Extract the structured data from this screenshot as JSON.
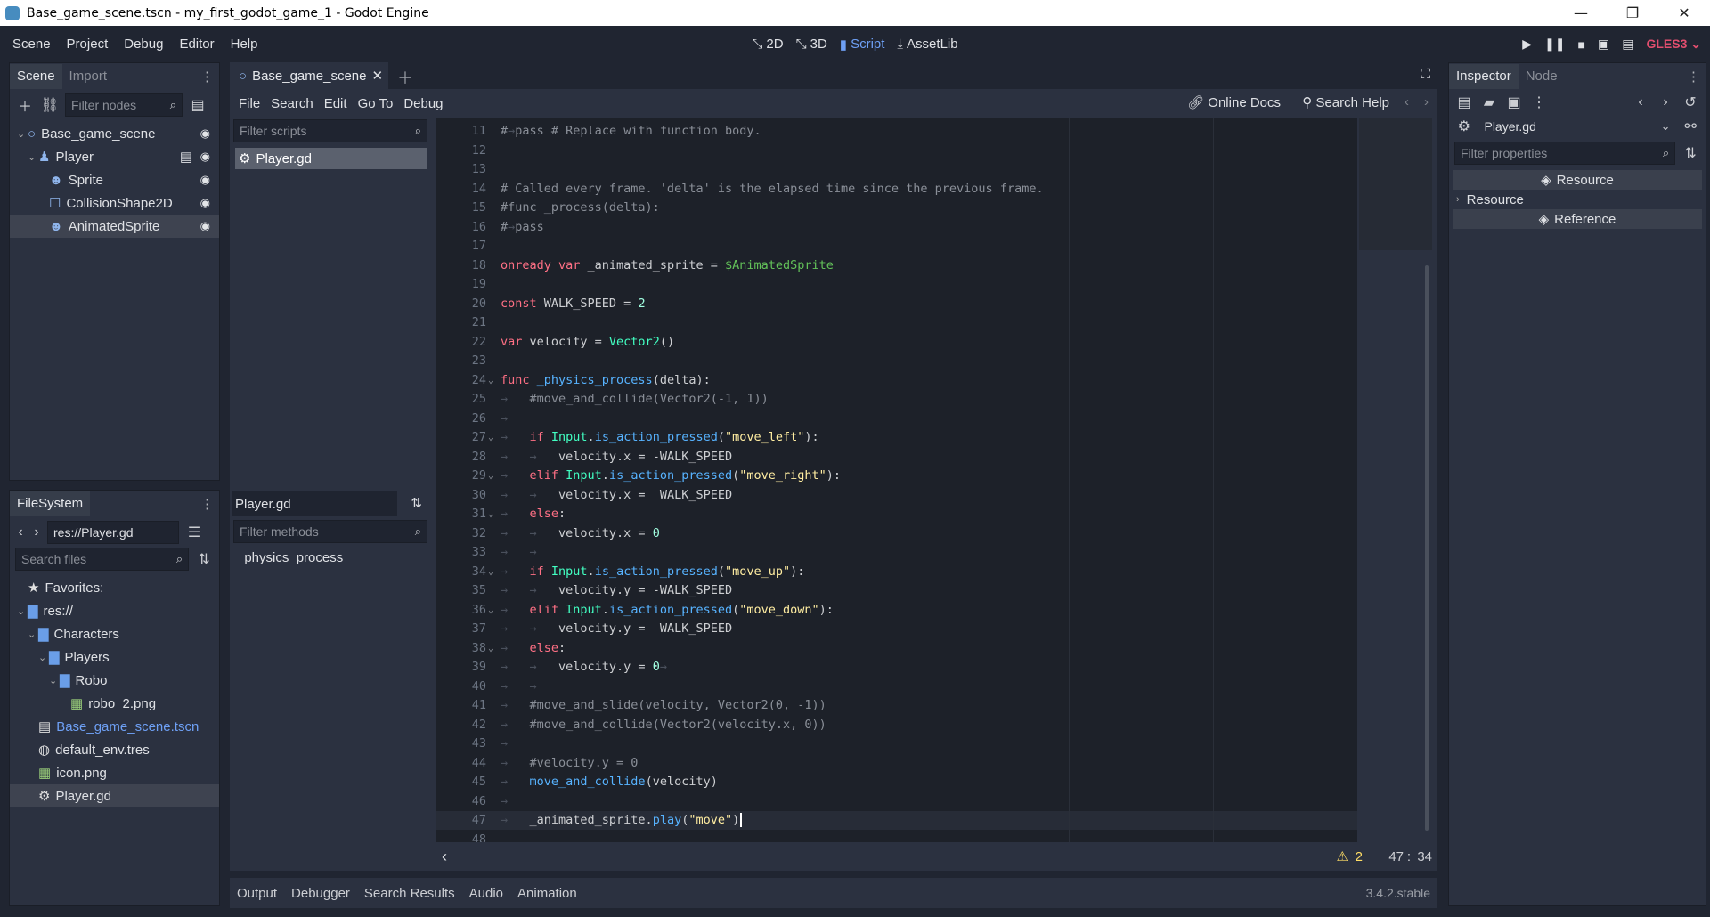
{
  "window": {
    "title": "Base_game_scene.tscn - my_first_godot_game_1 - Godot Engine",
    "minimize": "—",
    "maximize": "❐",
    "close": "✕"
  },
  "menu": [
    "Scene",
    "Project",
    "Debug",
    "Editor",
    "Help"
  ],
  "workspaces": [
    {
      "label": "2D",
      "icon": "2d-icon",
      "active": false
    },
    {
      "label": "3D",
      "icon": "3d-icon",
      "active": false
    },
    {
      "label": "Script",
      "icon": "script-icon",
      "active": true
    },
    {
      "label": "AssetLib",
      "icon": "assetlib-icon",
      "active": false
    }
  ],
  "renderer": "GLES3",
  "scene_dock": {
    "tabs": [
      "Scene",
      "Import"
    ],
    "filter_placeholder": "Filter nodes",
    "nodes": [
      {
        "name": "Base_game_scene",
        "depth": 0,
        "icon": "node2d-icon",
        "visible": true,
        "expanded": true
      },
      {
        "name": "Player",
        "depth": 1,
        "icon": "kinematicbody-icon",
        "visible": true,
        "expanded": true,
        "script": true
      },
      {
        "name": "Sprite",
        "depth": 2,
        "icon": "sprite-icon",
        "visible": true
      },
      {
        "name": "CollisionShape2D",
        "depth": 2,
        "icon": "collisionshape-icon",
        "visible": true
      },
      {
        "name": "AnimatedSprite",
        "depth": 2,
        "icon": "animatedsprite-icon",
        "visible": true,
        "selected": true
      }
    ]
  },
  "filesystem": {
    "tab": "FileSystem",
    "path": "res://Player.gd",
    "search_placeholder": "Search files",
    "items": [
      {
        "name": "Favorites:",
        "depth": 0,
        "icon": "star-icon"
      },
      {
        "name": "res://",
        "depth": 0,
        "icon": "folder-icon",
        "expanded": true
      },
      {
        "name": "Characters",
        "depth": 1,
        "icon": "folder-icon",
        "expanded": true
      },
      {
        "name": "Players",
        "depth": 2,
        "icon": "folder-icon",
        "expanded": true
      },
      {
        "name": "Robo",
        "depth": 3,
        "icon": "folder-icon",
        "expanded": true
      },
      {
        "name": "robo_2.png",
        "depth": 4,
        "icon": "image-icon"
      },
      {
        "name": "Base_game_scene.tscn",
        "depth": 1,
        "icon": "scene-icon",
        "highlight": true
      },
      {
        "name": "default_env.tres",
        "depth": 1,
        "icon": "globe-icon"
      },
      {
        "name": "icon.png",
        "depth": 1,
        "icon": "image-icon"
      },
      {
        "name": "Player.gd",
        "depth": 1,
        "icon": "gear-icon",
        "selected": true
      }
    ]
  },
  "script_editor": {
    "open_tab": "Base_game_scene",
    "menu": [
      "File",
      "Search",
      "Edit",
      "Go To",
      "Debug"
    ],
    "online_docs": "Online Docs",
    "search_help": "Search Help",
    "filter_scripts_placeholder": "Filter scripts",
    "scripts": [
      "Player.gd"
    ],
    "current_script": "Player.gd",
    "filter_methods_placeholder": "Filter methods",
    "methods": [
      "_physics_process"
    ],
    "status": {
      "warnings": "2",
      "line": "47",
      "sep": ":",
      "col": "34"
    },
    "lines": [
      {
        "n": "11",
        "tokens": [
          [
            "c-comment",
            "#"
          ],
          [
            "tabsym",
            "→"
          ],
          [
            "c-comment",
            "pass # Replace with function body."
          ]
        ]
      },
      {
        "n": "12",
        "tokens": []
      },
      {
        "n": "13",
        "tokens": []
      },
      {
        "n": "14",
        "tokens": [
          [
            "c-comment",
            "# Called every frame. 'delta' is the elapsed time since the previous frame."
          ]
        ]
      },
      {
        "n": "15",
        "tokens": [
          [
            "c-comment",
            "#func _process(delta):"
          ]
        ]
      },
      {
        "n": "16",
        "tokens": [
          [
            "c-comment",
            "#"
          ],
          [
            "tabsym",
            "→"
          ],
          [
            "c-comment",
            "pass"
          ]
        ]
      },
      {
        "n": "17",
        "tokens": []
      },
      {
        "n": "18",
        "tokens": [
          [
            "c-kw",
            "onready var "
          ],
          [
            "c-id",
            "_animated_sprite = "
          ],
          [
            "c-node",
            "$AnimatedSprite"
          ]
        ]
      },
      {
        "n": "19",
        "tokens": []
      },
      {
        "n": "20",
        "tokens": [
          [
            "c-kw",
            "const "
          ],
          [
            "c-id",
            "WALK_SPEED = "
          ],
          [
            "c-num",
            "2"
          ]
        ]
      },
      {
        "n": "21",
        "tokens": []
      },
      {
        "n": "22",
        "tokens": [
          [
            "c-kw",
            "var "
          ],
          [
            "c-id",
            "velocity = "
          ],
          [
            "c-type",
            "Vector2"
          ],
          [
            "c-id",
            "()"
          ]
        ]
      },
      {
        "n": "23",
        "tokens": []
      },
      {
        "n": "24",
        "fold": true,
        "tokens": [
          [
            "c-kw",
            "func "
          ],
          [
            "c-fn",
            "_physics_process"
          ],
          [
            "c-id",
            "(delta):"
          ]
        ]
      },
      {
        "n": "25",
        "tokens": [
          [
            "tabsym",
            "→   "
          ],
          [
            "c-comment",
            "#move_and_collide(Vector2(-1, 1))"
          ]
        ]
      },
      {
        "n": "26",
        "tokens": [
          [
            "tabsym",
            "→"
          ]
        ]
      },
      {
        "n": "27",
        "fold": true,
        "tokens": [
          [
            "tabsym",
            "→   "
          ],
          [
            "c-kw",
            "if "
          ],
          [
            "c-type",
            "Input"
          ],
          [
            "c-id",
            "."
          ],
          [
            "c-fn",
            "is_action_pressed"
          ],
          [
            "c-id",
            "("
          ],
          [
            "c-str",
            "\"move_left\""
          ],
          [
            "c-id",
            "):"
          ]
        ]
      },
      {
        "n": "28",
        "tokens": [
          [
            "tabsym",
            "→   →   "
          ],
          [
            "c-id",
            "velocity.x = -WALK_SPEED"
          ]
        ]
      },
      {
        "n": "29",
        "fold": true,
        "tokens": [
          [
            "tabsym",
            "→   "
          ],
          [
            "c-kw",
            "elif "
          ],
          [
            "c-type",
            "Input"
          ],
          [
            "c-id",
            "."
          ],
          [
            "c-fn",
            "is_action_pressed"
          ],
          [
            "c-id",
            "("
          ],
          [
            "c-str",
            "\"move_right\""
          ],
          [
            "c-id",
            "):"
          ]
        ]
      },
      {
        "n": "30",
        "tokens": [
          [
            "tabsym",
            "→   →   "
          ],
          [
            "c-id",
            "velocity.x =  WALK_SPEED"
          ]
        ]
      },
      {
        "n": "31",
        "fold": true,
        "tokens": [
          [
            "tabsym",
            "→   "
          ],
          [
            "c-kw",
            "else"
          ],
          [
            "c-id",
            ":"
          ]
        ]
      },
      {
        "n": "32",
        "tokens": [
          [
            "tabsym",
            "→   →   "
          ],
          [
            "c-id",
            "velocity.x = "
          ],
          [
            "c-num",
            "0"
          ]
        ]
      },
      {
        "n": "33",
        "tokens": [
          [
            "tabsym",
            "→   →"
          ]
        ]
      },
      {
        "n": "34",
        "fold": true,
        "tokens": [
          [
            "tabsym",
            "→   "
          ],
          [
            "c-kw",
            "if "
          ],
          [
            "c-type",
            "Input"
          ],
          [
            "c-id",
            "."
          ],
          [
            "c-fn",
            "is_action_pressed"
          ],
          [
            "c-id",
            "("
          ],
          [
            "c-str",
            "\"move_up\""
          ],
          [
            "c-id",
            "):"
          ]
        ]
      },
      {
        "n": "35",
        "tokens": [
          [
            "tabsym",
            "→   →   "
          ],
          [
            "c-id",
            "velocity.y = -WALK_SPEED"
          ]
        ]
      },
      {
        "n": "36",
        "fold": true,
        "tokens": [
          [
            "tabsym",
            "→   "
          ],
          [
            "c-kw",
            "elif "
          ],
          [
            "c-type",
            "Input"
          ],
          [
            "c-id",
            "."
          ],
          [
            "c-fn",
            "is_action_pressed"
          ],
          [
            "c-id",
            "("
          ],
          [
            "c-str",
            "\"move_down\""
          ],
          [
            "c-id",
            "):"
          ]
        ]
      },
      {
        "n": "37",
        "tokens": [
          [
            "tabsym",
            "→   →   "
          ],
          [
            "c-id",
            "velocity.y =  WALK_SPEED"
          ]
        ]
      },
      {
        "n": "38",
        "fold": true,
        "tokens": [
          [
            "tabsym",
            "→   "
          ],
          [
            "c-kw",
            "else"
          ],
          [
            "c-id",
            ":"
          ]
        ]
      },
      {
        "n": "39",
        "tokens": [
          [
            "tabsym",
            "→   →   "
          ],
          [
            "c-id",
            "velocity.y = "
          ],
          [
            "c-num",
            "0"
          ],
          [
            "tabsym",
            "→"
          ]
        ]
      },
      {
        "n": "40",
        "tokens": [
          [
            "tabsym",
            "→   →"
          ]
        ]
      },
      {
        "n": "41",
        "tokens": [
          [
            "tabsym",
            "→   "
          ],
          [
            "c-comment",
            "#move_and_slide(velocity, Vector2(0, -1))"
          ]
        ]
      },
      {
        "n": "42",
        "tokens": [
          [
            "tabsym",
            "→   "
          ],
          [
            "c-comment",
            "#move_and_collide(Vector2(velocity.x, 0))"
          ]
        ]
      },
      {
        "n": "43",
        "tokens": [
          [
            "tabsym",
            "→"
          ]
        ]
      },
      {
        "n": "44",
        "tokens": [
          [
            "tabsym",
            "→   "
          ],
          [
            "c-comment",
            "#velocity.y = 0"
          ]
        ]
      },
      {
        "n": "45",
        "tokens": [
          [
            "tabsym",
            "→   "
          ],
          [
            "c-fn",
            "move_and_collide"
          ],
          [
            "c-id",
            "(velocity)"
          ]
        ]
      },
      {
        "n": "46",
        "tokens": [
          [
            "tabsym",
            "→"
          ]
        ]
      },
      {
        "n": "47",
        "current": true,
        "tokens": [
          [
            "tabsym",
            "→   "
          ],
          [
            "c-id",
            "_animated_sprite."
          ],
          [
            "c-fn",
            "play"
          ],
          [
            "c-id",
            "("
          ],
          [
            "c-str",
            "\"move\""
          ],
          [
            "c-id",
            ")"
          ]
        ]
      },
      {
        "n": "48",
        "tokens": []
      }
    ]
  },
  "inspector": {
    "tabs": [
      "Inspector",
      "Node"
    ],
    "object": "Player.gd",
    "filter_placeholder": "Filter properties",
    "rows": [
      {
        "label": "Resource",
        "type": "section"
      },
      {
        "label": "Resource",
        "type": "group"
      },
      {
        "label": "Reference",
        "type": "section"
      }
    ]
  },
  "bottom_panel": {
    "tabs": [
      "Output",
      "Debugger",
      "Search Results",
      "Audio",
      "Animation"
    ],
    "version": "3.4.2.stable"
  },
  "colors": {
    "accent": "#6ea0f5",
    "renderer": "#e14e6e",
    "background": "#202531",
    "panel": "#2b3140",
    "editor": "#1d2129"
  }
}
